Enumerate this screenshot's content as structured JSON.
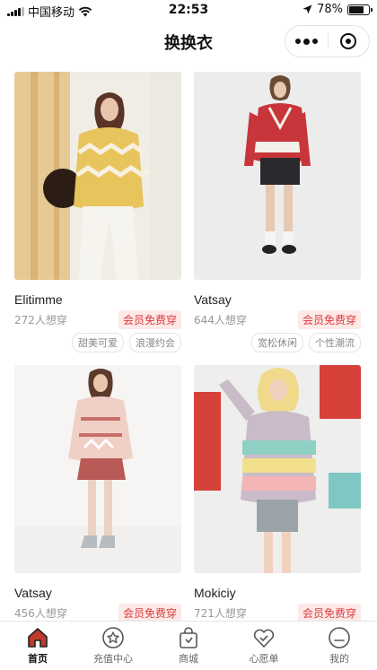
{
  "status_bar": {
    "carrier": "中国移动",
    "time": "22:53",
    "battery": "78%",
    "battery_level": 0.78
  },
  "nav": {
    "title": "换换衣"
  },
  "products": [
    {
      "brand": "Elitimme",
      "wants": "272人想穿",
      "badge": "会员免费穿",
      "tags": [
        "甜美可爱",
        "浪漫约会"
      ]
    },
    {
      "brand": "Vatsay",
      "wants": "644人想穿",
      "badge": "会员免费穿",
      "tags": [
        "宽松休闲",
        "个性潮流"
      ]
    },
    {
      "brand": "Vatsay",
      "wants": "456人想穿",
      "badge": "会员免费穿",
      "tags": []
    },
    {
      "brand": "Mokiciy",
      "wants": "721人想穿",
      "badge": "会员免费穿",
      "tags": []
    }
  ],
  "tabs": [
    {
      "label": "首页",
      "icon": "home-icon",
      "active": true
    },
    {
      "label": "充值中心",
      "icon": "recharge-star-icon",
      "active": false
    },
    {
      "label": "商城",
      "icon": "shopping-bag-icon",
      "active": false
    },
    {
      "label": "心愿单",
      "icon": "heart-icon",
      "active": false
    },
    {
      "label": "我的",
      "icon": "profile-icon",
      "active": false
    }
  ],
  "colors": {
    "accent_red": "#d93d3d",
    "badge_bg": "#fde9e8",
    "home_icon_red": "#c0392b"
  }
}
